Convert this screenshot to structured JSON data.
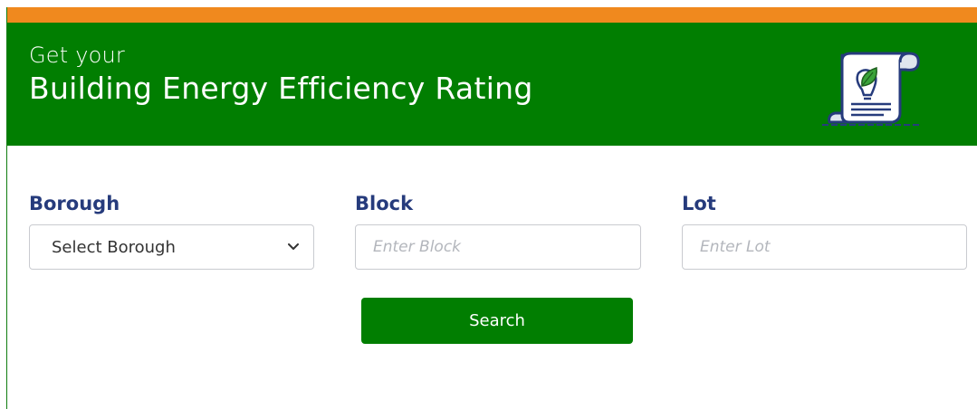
{
  "hero": {
    "subtitle": "Get your",
    "title": "Building Energy Efficiency Rating",
    "icon": "certificate-scroll-leaf-icon"
  },
  "form": {
    "borough": {
      "label": "Borough",
      "selected": "Select Borough"
    },
    "block": {
      "label": "Block",
      "placeholder": "Enter Block",
      "value": ""
    },
    "lot": {
      "label": "Lot",
      "placeholder": "Enter Lot",
      "value": ""
    },
    "search_label": "Search"
  },
  "colors": {
    "accent_orange": "#f0891e",
    "brand_green": "#017e01",
    "label_navy": "#263b7c",
    "input_border": "#c9cbd0"
  }
}
